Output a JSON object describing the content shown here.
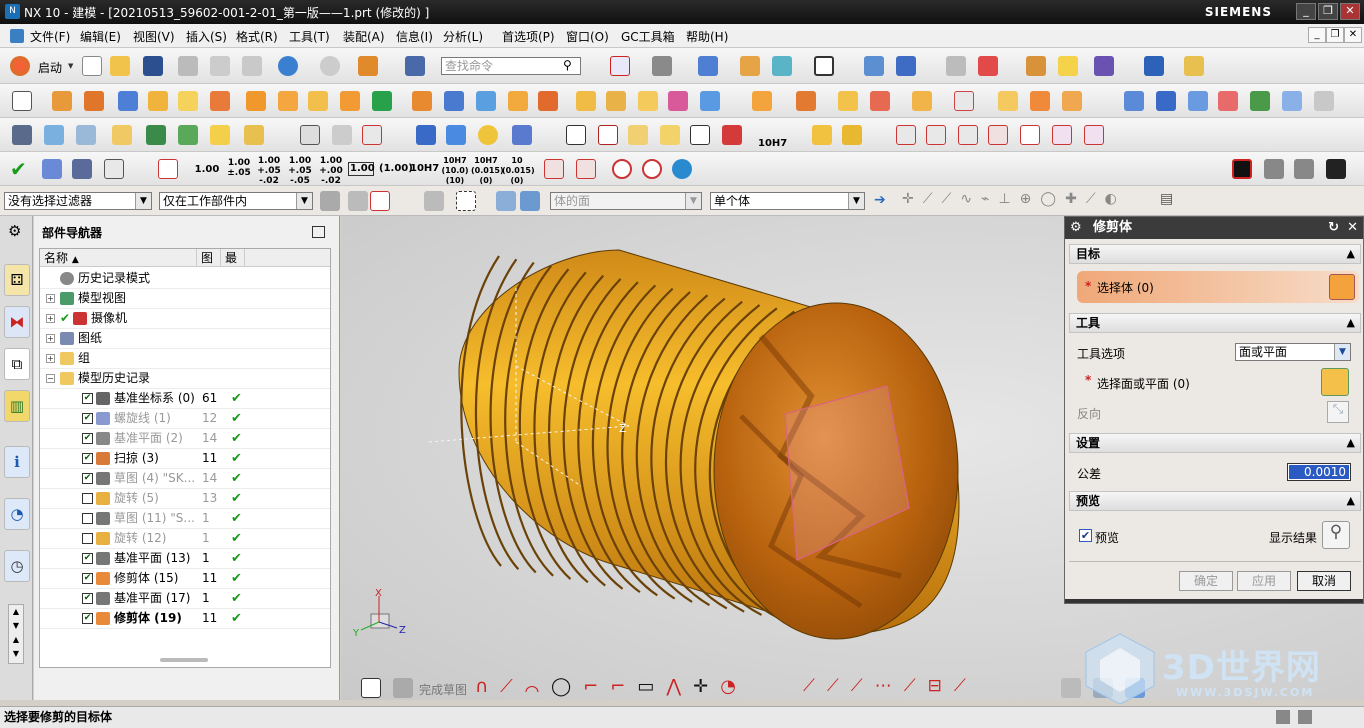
{
  "titlebar": {
    "title": "NX 10 - 建模 - [20210513_59602-001-2-01_第一版——1.prt  (修改的) ]",
    "brand": "SIEMENS",
    "minimize": "_",
    "restore": "❐",
    "close": "✕"
  },
  "menubar": {
    "items": [
      "文件(F)",
      "编辑(E)",
      "视图(V)",
      "插入(S)",
      "格式(R)",
      "工具(T)",
      "装配(A)",
      "信息(I)",
      "分析(L)",
      "首选项(P)",
      "窗口(O)",
      "GC工具箱",
      "帮助(H)"
    ]
  },
  "toolbar": {
    "start_label": "启动",
    "search_placeholder": "查找命令",
    "tolerances": [
      "1.00",
      "1.00\n±.05",
      "1.00\n+.05\n-.02",
      "1.00\n+.05\n-.05",
      "1.00\n+.00\n-.02",
      "1.00",
      "(1.00)",
      "10H7",
      "10H7\n(10.0)\n(10)",
      "10H7\n(0.015)\n(0)",
      "10\n(0.015)\n(0)"
    ],
    "hole_label": "10H7"
  },
  "selection_bar": {
    "filter": "没有选择过滤器",
    "scope": "仅在工作部件内",
    "face_rule": "体的面",
    "body_rule": "单个体"
  },
  "navigator": {
    "title": "部件导航器",
    "columns": [
      "名称",
      "图",
      "最"
    ],
    "rows": [
      {
        "label": "历史记录模式",
        "num": "",
        "latest": ""
      },
      {
        "label": "模型视图",
        "num": "",
        "latest": ""
      },
      {
        "label": "摄像机",
        "num": "",
        "latest": ""
      },
      {
        "label": "图纸",
        "num": "",
        "latest": ""
      },
      {
        "label": "组",
        "num": "",
        "latest": ""
      },
      {
        "label": "模型历史记录",
        "num": "",
        "latest": ""
      },
      {
        "label": "基准坐标系 (0)",
        "num": "61",
        "latest": "✔"
      },
      {
        "label": "螺旋线 (1)",
        "num": "12",
        "latest": "✔"
      },
      {
        "label": "基准平面 (2)",
        "num": "14",
        "latest": "✔"
      },
      {
        "label": "扫掠 (3)",
        "num": "11",
        "latest": "✔"
      },
      {
        "label": "草图 (4) \"SK...",
        "num": "14",
        "latest": "✔"
      },
      {
        "label": "旋转 (5)",
        "num": "13",
        "latest": "✔"
      },
      {
        "label": "草图 (11) \"S...",
        "num": "1",
        "latest": "✔"
      },
      {
        "label": "旋转 (12)",
        "num": "1",
        "latest": "✔"
      },
      {
        "label": "基准平面 (13)",
        "num": "1",
        "latest": "✔"
      },
      {
        "label": "修剪体 (15)",
        "num": "11",
        "latest": "✔"
      },
      {
        "label": "基准平面 (17)",
        "num": "1",
        "latest": "✔"
      },
      {
        "label": "修剪体 (19)",
        "num": "11",
        "latest": "✔"
      }
    ]
  },
  "viewport": {
    "axis_z": "Z",
    "triad_x": "X",
    "triad_y": "Y",
    "triad_z": "Z"
  },
  "dialog": {
    "title": "修剪体",
    "target_section": "目标",
    "select_body": "选择体 (0)",
    "tool_section": "工具",
    "tool_option_label": "工具选项",
    "tool_option_value": "面或平面",
    "select_face": "选择面或平面 (0)",
    "reverse": "反向",
    "settings_section": "设置",
    "tolerance_label": "公差",
    "tolerance_value": "0.0010",
    "preview_section": "预览",
    "preview_label": "预览",
    "show_result": "显示结果",
    "ok": "确定",
    "apply": "应用",
    "cancel": "取消"
  },
  "bottom_toolbar": {
    "finish_sketch": "完成草图"
  },
  "status": {
    "message": "选择要修剪的目标体"
  },
  "watermark": {
    "text": "3D世界网",
    "url": "WWW.3DSJW.COM"
  }
}
